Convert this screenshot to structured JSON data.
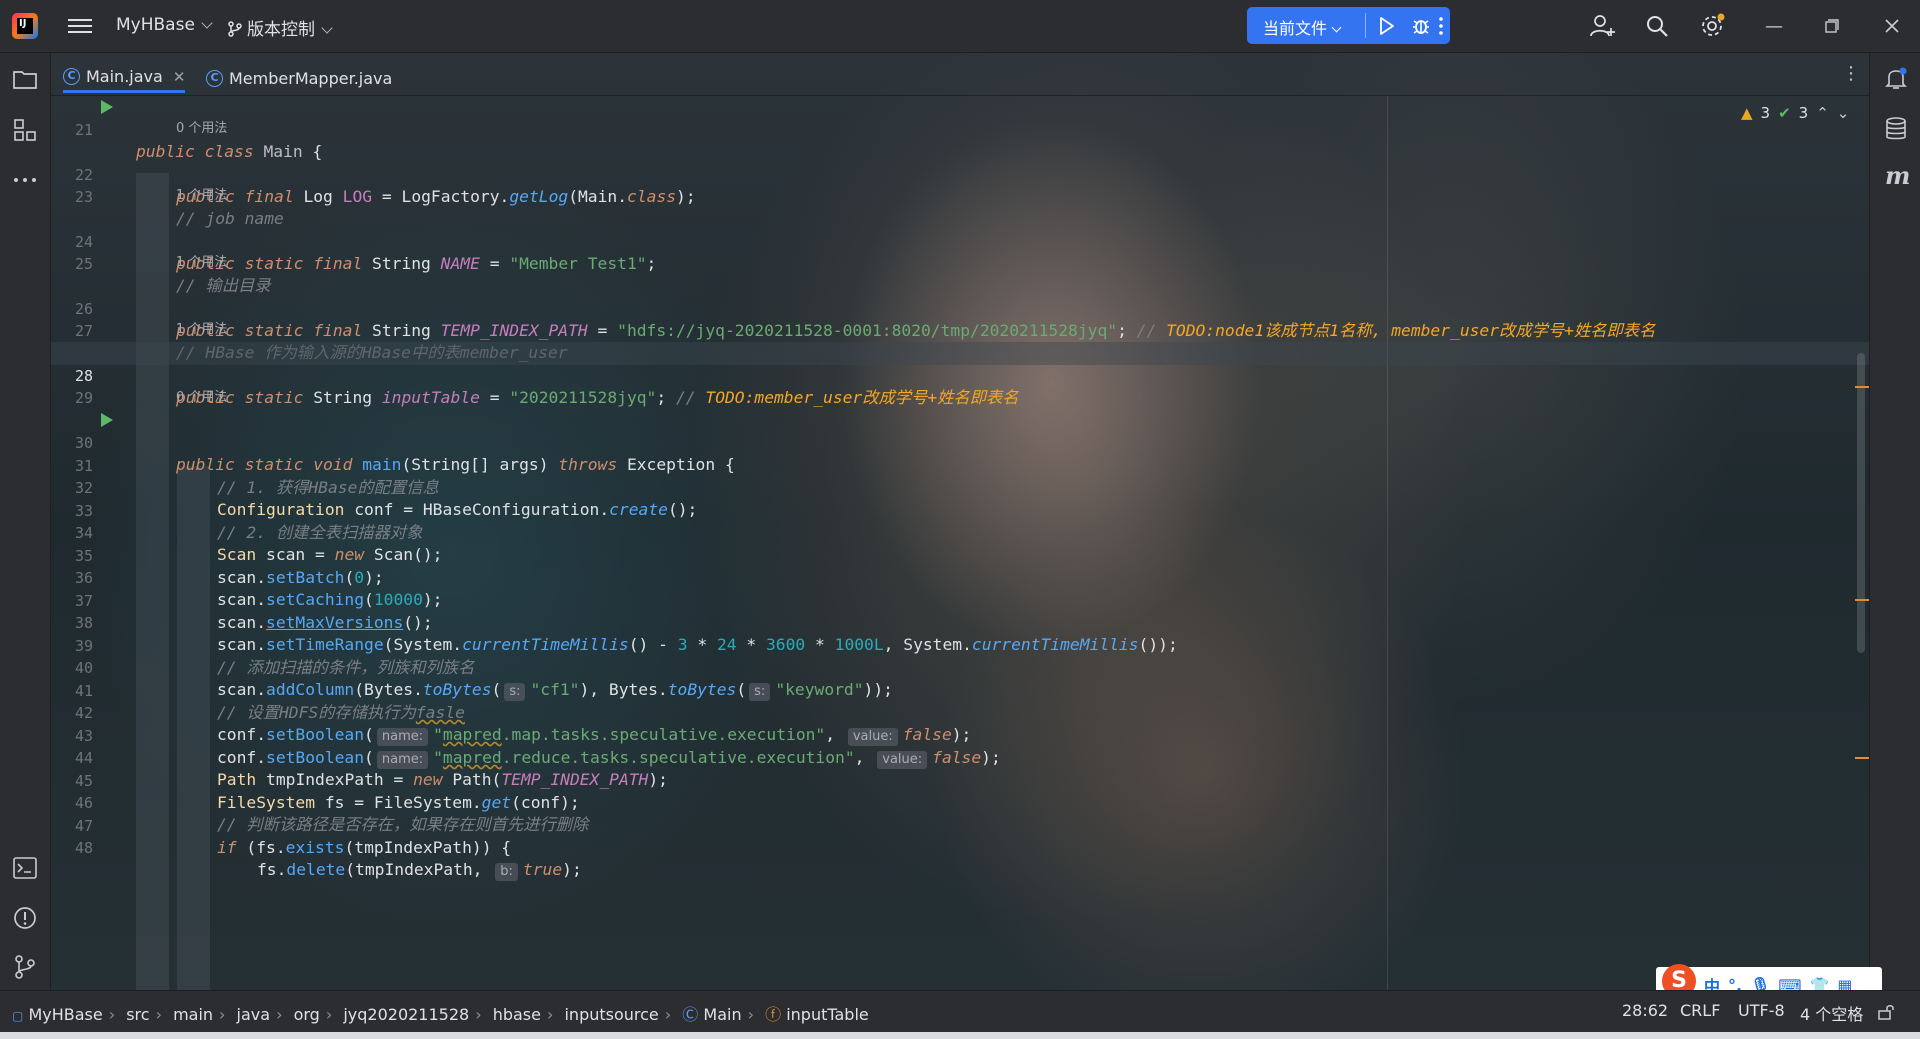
{
  "titlebar": {
    "project": "MyHBase",
    "vcs": "版本控制",
    "run_config": "当前文件"
  },
  "tabs": [
    {
      "label": "Main.java",
      "active": true
    },
    {
      "label": "MemberMapper.java",
      "active": false
    }
  ],
  "inspections": {
    "warnings": "3",
    "ok": "3"
  },
  "code": {
    "l21": "21",
    "l22": "22",
    "l23": "23",
    "l24": "24",
    "l25": "25",
    "l26": "26",
    "l27": "27",
    "l28": "28",
    "l29": "29",
    "l30": "30",
    "l31": "31",
    "l32": "32",
    "l33": "33",
    "l34": "34",
    "l35": "35",
    "l36": "36",
    "l37": "37",
    "l38": "38",
    "l39": "39",
    "l40": "40",
    "l41": "41",
    "l42": "42",
    "l43": "43",
    "l44": "44",
    "l45": "45",
    "l46": "46",
    "l47": "47",
    "l48": "48",
    "usage0": "0 个用法",
    "usage1": "1 个用法",
    "class_name": "Main",
    "log_name": "LOG",
    "log_type": "Log",
    "log_factory": "LogFactory",
    "get_log": "getLog",
    "main_ref": "Main",
    "c_job": "// job name",
    "name_field": "NAME",
    "name_value": "\"Member Test1\"",
    "c_out": "// 输出目录",
    "temp_field": "TEMP_INDEX_PATH",
    "temp_value": "\"hdfs://jyq-2020211528-0001:8020/tmp/2020211528jyq\"",
    "todo_node": "TODO:node1该成节点1名称, member_user改成学号+姓名即表名",
    "c_hbase": "// HBase 作为输入源的HBase中的表member_user",
    "input_field": "inputTable",
    "input_value": "\"2020211528jyq\"",
    "todo_member": "TODO:member_user改成学号+姓名即表名",
    "main_fn": "main",
    "c1": "// 1. 获得HBase的配置信息",
    "conf_type": "Configuration",
    "hbase_conf": "HBaseConfiguration",
    "create_fn": "create",
    "c2": "// 2. 创建全表扫描器对象",
    "set_batch": "setBatch",
    "batch_val": "0",
    "set_caching": "setCaching",
    "caching_val": "10000",
    "set_maxv": "setMaxVersions",
    "set_time": "setTimeRange",
    "ctm": "currentTimeMillis",
    "n3": "3",
    "n24": "24",
    "n3600": "3600",
    "n1000": "1000L",
    "c_add": "// 添加扫描的条件，列族和列族名",
    "add_col": "addColumn",
    "to_bytes": "toBytes",
    "hint_s": "s:",
    "cf1": "\"cf1\"",
    "keyword": "\"keyword\"",
    "c_hdfs": "// 设置HDFS的存储执行为",
    "fasle": "fasle",
    "set_bool": "setBoolean",
    "hint_name": "name:",
    "hint_value": "value:",
    "hint_b": "b:",
    "map_q": "\"",
    "mapred": "mapred",
    "map_rest": ".map.tasks.speculative.execution\"",
    "reduce_rest": ".reduce.tasks.speculative.execution\"",
    "false_kw": "false",
    "true_kw": "true",
    "path_type": "Path",
    "tmp_var": "tmpIndexPath",
    "fs_type": "FileSystem",
    "get_fn": "get",
    "c_check": "// 判断该路径是否存在，如果存在则首先进行删除",
    "exists_fn": "exists",
    "delete_fn": "delete"
  },
  "statusbar": {
    "crumbs": [
      "MyHBase",
      "src",
      "main",
      "java",
      "org",
      "jyq2020211528",
      "hbase",
      "inputsource",
      "Main",
      "inputTable"
    ],
    "position": "28:62",
    "line_sep": "CRLF",
    "encoding": "UTF-8",
    "indent": "4 个空格"
  },
  "ime": {
    "lang": "中",
    "punct": "°,"
  },
  "colors": {
    "accent": "#3574f0",
    "keyword": "#cf8e6d",
    "string": "#6aab73",
    "field": "#c77dbb",
    "todo": "#f5a623",
    "method": "#56a8f5"
  }
}
